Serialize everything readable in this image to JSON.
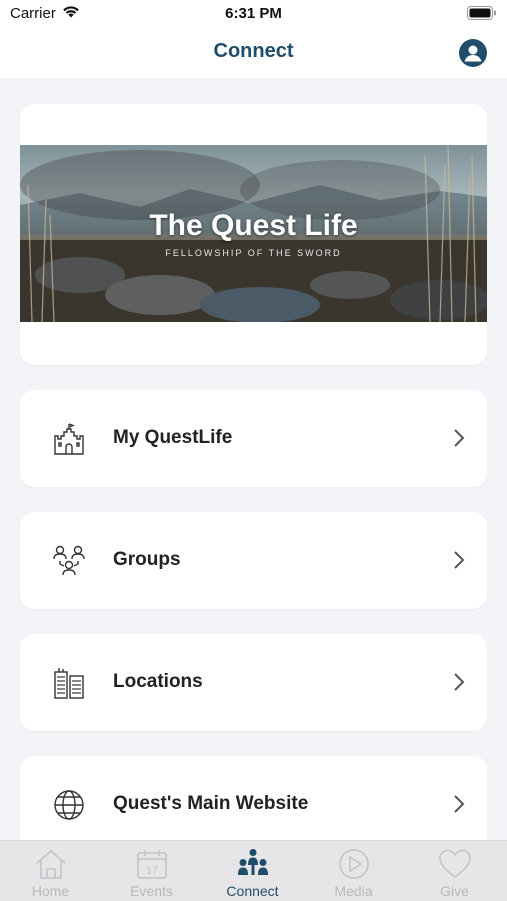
{
  "status_bar": {
    "carrier": "Carrier",
    "time": "6:31 PM"
  },
  "nav": {
    "title": "Connect"
  },
  "banner": {
    "title": "The Quest Life",
    "subtitle": "FELLOWSHIP OF THE SWORD"
  },
  "menu": [
    {
      "label": "My QuestLife",
      "icon": "castle-icon"
    },
    {
      "label": "Groups",
      "icon": "people-group-icon"
    },
    {
      "label": "Locations",
      "icon": "buildings-icon"
    },
    {
      "label": "Quest's Main Website",
      "icon": "globe-icon"
    }
  ],
  "tabs": [
    {
      "label": "Home",
      "icon": "home-icon",
      "active": false
    },
    {
      "label": "Events",
      "icon": "calendar-icon",
      "active": false,
      "badge": "17"
    },
    {
      "label": "Connect",
      "icon": "people-icon",
      "active": true
    },
    {
      "label": "Media",
      "icon": "play-icon",
      "active": false
    },
    {
      "label": "Give",
      "icon": "heart-icon",
      "active": false
    }
  ],
  "colors": {
    "accent": "#1f4e6b",
    "inactive_tab": "#b8b8bc",
    "background": "#f2f4f8"
  }
}
